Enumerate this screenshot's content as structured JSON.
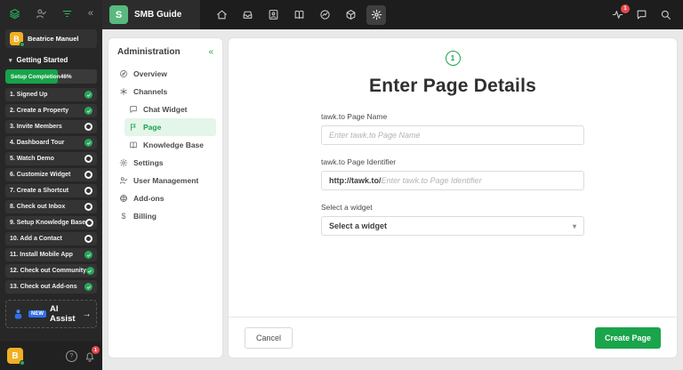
{
  "colors": {
    "accent_green": "#1aa44b",
    "progress_green": "#18a34a",
    "badge_red": "#e8484d",
    "new_badge_blue": "#2f6fed",
    "avatar_yellow": "#eeb024"
  },
  "glyphs": {
    "collapse": "«",
    "caret_down": "▾",
    "chevron_down": "▾",
    "arrow_right": "→",
    "dollar": "$",
    "help": "?"
  },
  "topbar": {
    "brand": {
      "initial": "S",
      "name": "SMB Guide"
    },
    "notification_count": "1"
  },
  "sidebar": {
    "user": {
      "name": "Beatrice Manuel",
      "initial": "B"
    },
    "section_title": "Getting Started",
    "progress": {
      "label": "Setup Completion",
      "percent": "46%",
      "fill_style": "width:57%"
    },
    "checklist": [
      {
        "label": "1. Signed Up",
        "status": "done"
      },
      {
        "label": "2. Create a Property",
        "status": "done"
      },
      {
        "label": "3. Invite Members",
        "status": "todo"
      },
      {
        "label": "4. Dashboard Tour",
        "status": "done"
      },
      {
        "label": "5. Watch Demo",
        "status": "todo"
      },
      {
        "label": "6. Customize Widget",
        "status": "todo"
      },
      {
        "label": "7. Create a Shortcut",
        "status": "todo"
      },
      {
        "label": "8. Check out Inbox",
        "status": "todo"
      },
      {
        "label": "9. Setup Knowledge Base",
        "status": "todo"
      },
      {
        "label": "10. Add a Contact",
        "status": "todo"
      },
      {
        "label": "11. Install Mobile App",
        "status": "done"
      },
      {
        "label": "12. Check out Community",
        "status": "done"
      },
      {
        "label": "13. Check out Add-ons",
        "status": "done"
      }
    ],
    "ai_assist": {
      "badge": "NEW",
      "label": "AI Assist"
    },
    "footer": {
      "avatar_initial": "B",
      "bell_badge": "1"
    }
  },
  "admin": {
    "title": "Administration",
    "items": {
      "overview": "Overview",
      "channels": "Channels",
      "chat_widget": "Chat Widget",
      "page": "Page",
      "knowledge_base": "Knowledge Base",
      "settings": "Settings",
      "user_management": "User Management",
      "addons": "Add-ons",
      "billing": "Billing"
    }
  },
  "main": {
    "step": "1",
    "title": "Enter Page Details",
    "fields": {
      "page_name": {
        "label": "tawk.to Page Name",
        "placeholder": "Enter tawk.to Page Name"
      },
      "page_identifier": {
        "label": "tawk.to Page Identifier",
        "prefix": "http://tawk.to/",
        "placeholder": "Enter tawk.to Page Identifier"
      },
      "widget": {
        "label": "Select a widget",
        "value": "Select a widget"
      }
    },
    "cancel": "Cancel",
    "submit": "Create Page"
  }
}
